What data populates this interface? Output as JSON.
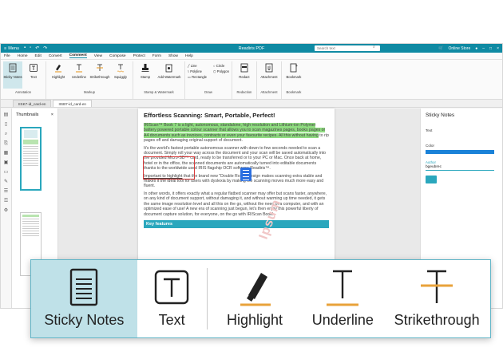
{
  "titlebar": {
    "menu_label": "Menu",
    "title": "Readiris PDF",
    "search_placeholder": "Search text",
    "online_store": "Online Store"
  },
  "menubar": [
    "File",
    "Home",
    "Edit",
    "Convert",
    "Comment",
    "View",
    "Compose",
    "Protect",
    "Form",
    "Show",
    "Help"
  ],
  "menubar_active": "Comment",
  "ribbon": {
    "annotation": {
      "label": "Annotation",
      "sticky": "Sticky Notes",
      "text": "Text"
    },
    "markup": {
      "label": "Markup",
      "highlight": "Highlight",
      "underline": "Underline",
      "strike": "Strikethrough",
      "squiggly": "Squiggly"
    },
    "stamp": {
      "label": "Stamp & Watermark",
      "stamp": "Stamp",
      "watermark": "Add Watermark"
    },
    "draw": {
      "label": "Draw",
      "line": "Line",
      "polyline": "Polyline",
      "rectangle": "Rectangle",
      "circle": "Circle",
      "polygon": "Polygon"
    },
    "redaction": {
      "label": "Redaction",
      "redact": "Redact"
    },
    "attachment": {
      "label": "Attachment",
      "attachment": "Attachment"
    },
    "bookmark": {
      "label": "Bookmark",
      "bookmark": "Bookmark"
    }
  },
  "tabs": [
    "IISK7-id_card-en",
    "IISB7-id_card-en"
  ],
  "thumbnails": {
    "title": "Thumbnails"
  },
  "document": {
    "title": "Effortless Scanning: Smart, Portable, Perfect!",
    "p1_hl": "IRIScan™ Book 7 is a light, autonomous, standalone, high resolution and Lithium-ion Polymer battery powered portable colour scanner that allows you to scan magazines pages, books pages or A4 documents such as invoices, contracts or even your favourite recipes. All this without having",
    "p1_rest": " to rip pages off and damaging original support of document.",
    "p2": "It's the world's fastest portable autonomous scanner with down to few seconds needed to scan a document. Simply roll your way across the document and your scan will be saved automatically into the provided Micro-SD™ card, ready to be transferred or to your PC or Mac. Once back at home, hotel or in the office, the scanned documents are automatically turned into editable documents thanks to the worldwide used IRIS flagship OCR software Readiris™.",
    "p3_ul": "Important to highlight",
    "p3_rest": " that the brand new \"Double Roller\" design makes scanning extra stable and makes it the ideal tool for users with dyslexia by making the scanning moves much more easy and fluent.",
    "p4": "In other words, it offers exactly what a regular flatbed scanner may offer but scans faster, anywhere, on any kind of document support, without damaging it, and without warming up time needed, it gets the same image resolution level and all this on the go, without the need of a computer, and with an optimized ease of use! A new era of scanning just begun, let's then enjoy this powerful liberty of document capture solution, for everyone, on the go with IRIScan Book!",
    "key_features": "Key features",
    "watermark": "Ipsum"
  },
  "right_panel": {
    "title": "Sticky Notes",
    "text_label": "Text",
    "color_label": "Color",
    "author_label": "Author",
    "author_value": "bgeubrec"
  },
  "zoom": {
    "sticky": "Sticky Notes",
    "text": "Text",
    "highlight": "Highlight",
    "underline": "Underline",
    "strike": "Strikethrough"
  },
  "colors": {
    "accent": "#0f8aa3",
    "highlight": "#8fdc80",
    "underline_marker": "#e8a23a",
    "selected_bg": "#bfe1e8"
  }
}
